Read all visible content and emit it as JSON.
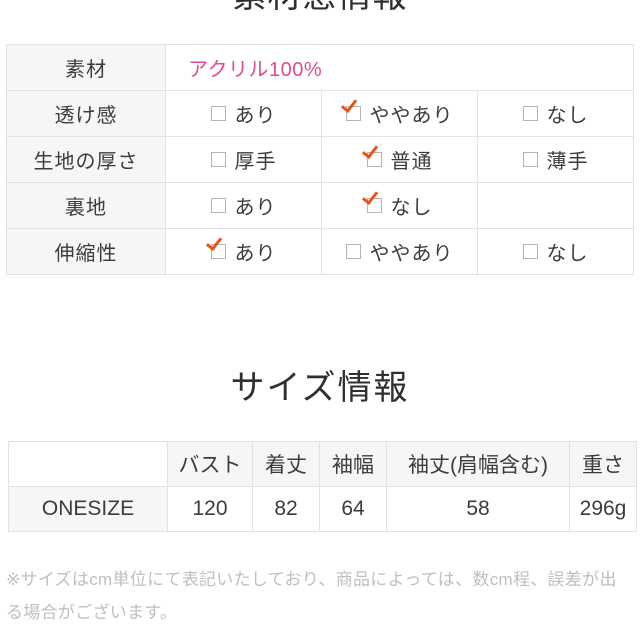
{
  "page": {
    "top_heading": "素材感情報"
  },
  "material_table": {
    "rows": [
      {
        "label": "素材",
        "type": "text",
        "value": "アクリル100%",
        "value_color": "#e54b8c"
      },
      {
        "label": "透け感",
        "type": "options",
        "options": [
          {
            "label": "あり",
            "checked": false
          },
          {
            "label": "ややあり",
            "checked": true
          },
          {
            "label": "なし",
            "checked": false
          }
        ]
      },
      {
        "label": "生地の厚さ",
        "type": "options",
        "options": [
          {
            "label": "厚手",
            "checked": false
          },
          {
            "label": "普通",
            "checked": true
          },
          {
            "label": "薄手",
            "checked": false
          }
        ]
      },
      {
        "label": "裏地",
        "type": "options",
        "options": [
          {
            "label": "あり",
            "checked": false
          },
          {
            "label": "なし",
            "checked": true
          },
          {
            "label": "",
            "checked": false,
            "empty": true
          }
        ]
      },
      {
        "label": "伸縮性",
        "type": "options",
        "options": [
          {
            "label": "あり",
            "checked": true
          },
          {
            "label": "ややあり",
            "checked": false
          },
          {
            "label": "なし",
            "checked": false
          }
        ]
      }
    ]
  },
  "size_section": {
    "heading": "サイズ情報",
    "table": {
      "headers": [
        "",
        "バスト",
        "着丈",
        "袖幅",
        "袖丈(肩幅含む)",
        "重さ"
      ],
      "rows": [
        {
          "name": "ONESIZE",
          "values": [
            "120",
            "82",
            "64",
            "58",
            "296g"
          ]
        }
      ]
    }
  },
  "footnote": {
    "text": "※サイズはcm単位にて表記いたしており、商品によっては、数cm程、誤差が出る場合がございます。"
  },
  "colors": {
    "accent_pink": "#e54b8c",
    "check_orange": "#e8551a",
    "label_bg": "#f6f6f6",
    "border": "#e2e2e2",
    "text": "#3c3c3c",
    "muted": "#bfbfbf"
  }
}
